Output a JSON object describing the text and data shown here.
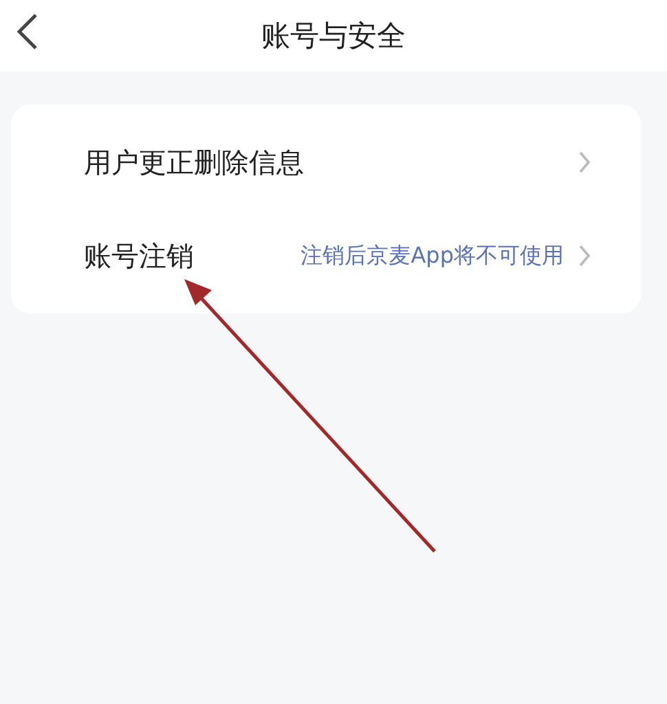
{
  "header": {
    "title": "账号与安全"
  },
  "items": [
    {
      "label": "用户更正删除信息"
    },
    {
      "label": "账号注销",
      "hint": "注销后京麦App将不可使用"
    }
  ]
}
